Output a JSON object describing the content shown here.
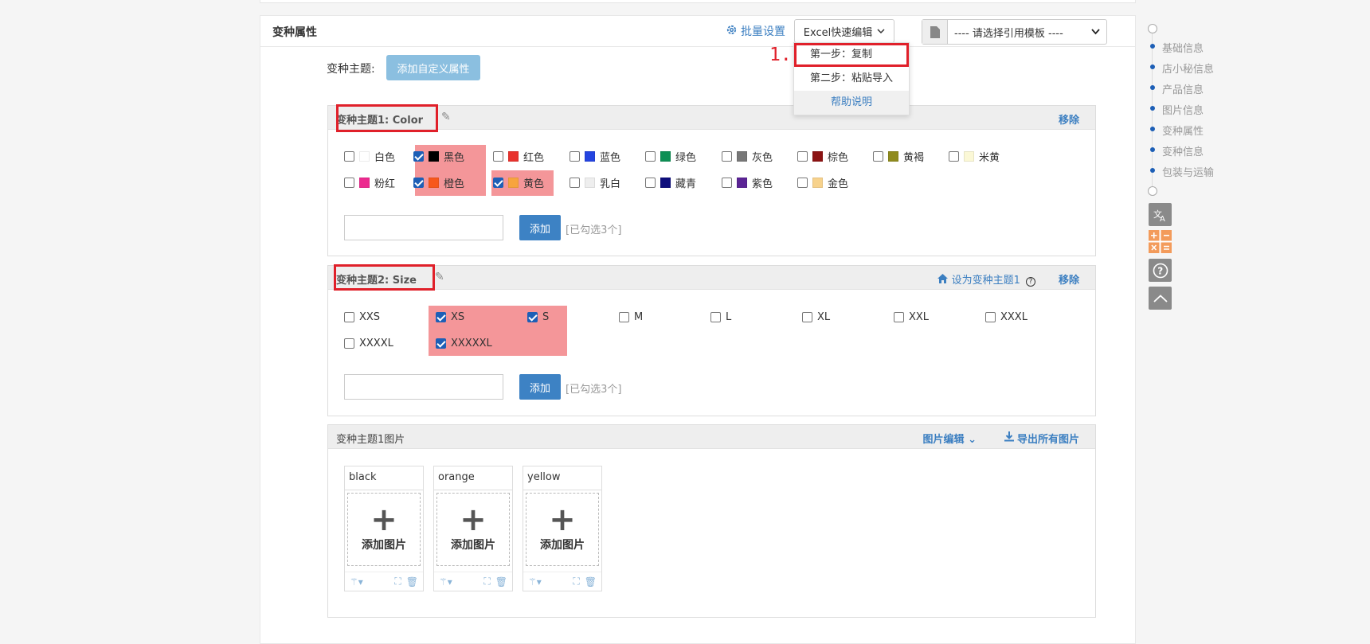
{
  "header": {
    "title": "变种属性",
    "batch_label": "批量设置",
    "excel_label": "Excel快速编辑",
    "template_placeholder": "---- 请选择引用模板 ----"
  },
  "excel_menu": {
    "step_marker": "1.",
    "items": [
      "第一步：复制",
      "第二步：粘贴导入"
    ],
    "help": "帮助说明"
  },
  "topic": {
    "label": "变种主题:",
    "add_custom": "添加自定义属性"
  },
  "panel1": {
    "title": "变种主题1:   Color",
    "remove": "移除",
    "add_btn": "添加",
    "count": "[已勾选3个]",
    "options": [
      {
        "label": "白色",
        "color": "#ffffff",
        "checked": false
      },
      {
        "label": "黑色",
        "color": "#000000",
        "checked": true
      },
      {
        "label": "红色",
        "color": "#e8322d",
        "checked": false
      },
      {
        "label": "蓝色",
        "color": "#2444e0",
        "checked": false
      },
      {
        "label": "绿色",
        "color": "#0e8f55",
        "checked": false
      },
      {
        "label": "灰色",
        "color": "#777777",
        "checked": false
      },
      {
        "label": "棕色",
        "color": "#8c1313",
        "checked": false
      },
      {
        "label": "黄褐",
        "color": "#8f8b1e",
        "checked": false
      },
      {
        "label": "米黄",
        "color": "#fbf8d6",
        "checked": false
      },
      {
        "label": "粉红",
        "color": "#ec2a8f",
        "checked": false
      },
      {
        "label": "橙色",
        "color": "#f7581c",
        "checked": true
      },
      {
        "label": "黄色",
        "color": "#f7a43e",
        "checked": true
      },
      {
        "label": "乳白",
        "color": "#eeeeee",
        "checked": false
      },
      {
        "label": "藏青",
        "color": "#0e0e7c",
        "checked": false
      },
      {
        "label": "紫色",
        "color": "#5b2495",
        "checked": false
      },
      {
        "label": "金色",
        "color": "#f7d28c",
        "checked": false
      }
    ]
  },
  "panel2": {
    "title": "变种主题2:   Size",
    "set_first": "设为变种主题1",
    "remove": "移除",
    "add_btn": "添加",
    "count": "[已勾选3个]",
    "options": [
      {
        "label": "XXS",
        "checked": false
      },
      {
        "label": "XS",
        "checked": true
      },
      {
        "label": "S",
        "checked": true
      },
      {
        "label": "M",
        "checked": false
      },
      {
        "label": "L",
        "checked": false
      },
      {
        "label": "XL",
        "checked": false
      },
      {
        "label": "XXL",
        "checked": false
      },
      {
        "label": "XXXL",
        "checked": false
      },
      {
        "label": "XXXXL",
        "checked": false
      },
      {
        "label": "XXXXXL",
        "checked": true
      }
    ]
  },
  "panel3": {
    "title": "变种主题1图片",
    "edit": "图片编辑",
    "export": "导出所有图片",
    "add_image": "添加图片",
    "cards": [
      "black",
      "orange",
      "yellow"
    ]
  },
  "nav": {
    "items": [
      "基础信息",
      "店小秘信息",
      "产品信息",
      "图片信息",
      "变种属性",
      "变种信息",
      "包装与运输"
    ]
  }
}
